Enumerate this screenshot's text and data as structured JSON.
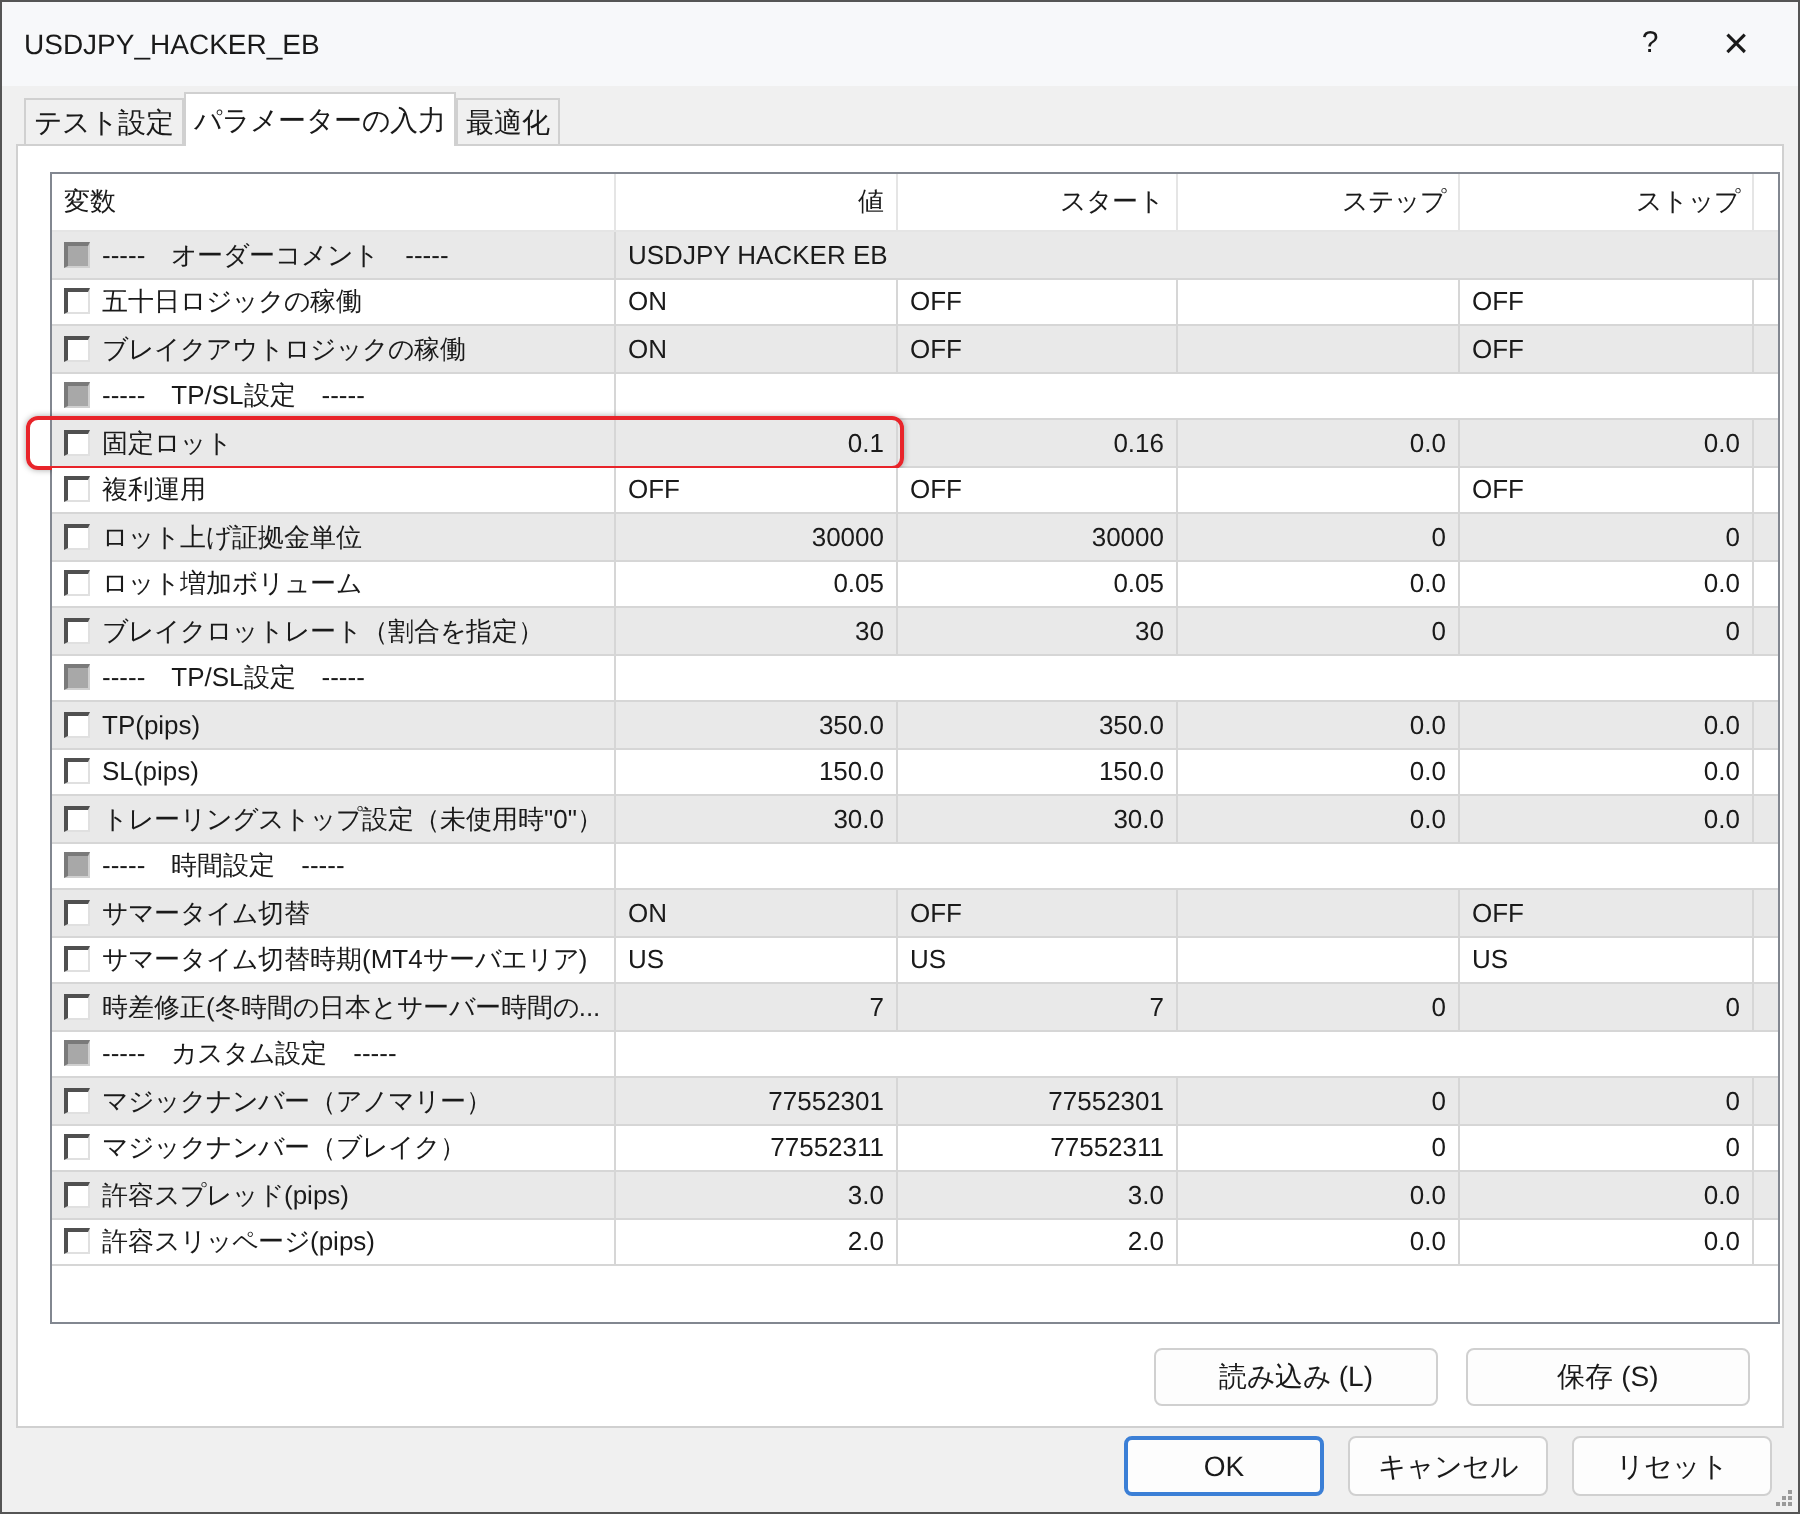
{
  "window": {
    "title": "USDJPY_HACKER_EB",
    "help": "?",
    "close": "×"
  },
  "tabs": [
    {
      "label": "テスト設定",
      "selected": false
    },
    {
      "label": "パラメーターの入力",
      "selected": true
    },
    {
      "label": "最適化",
      "selected": false
    }
  ],
  "table": {
    "columns": [
      "変数",
      "値",
      "スタート",
      "ステップ",
      "ストップ"
    ],
    "rows": [
      {
        "kind": "section",
        "name": "-----　オーダーコメント　-----",
        "checked": false,
        "disabled": true,
        "comment": "USDJPY HACKER EB",
        "highlighted": false
      },
      {
        "kind": "text",
        "name": "五十日ロジックの稼働",
        "checked": false,
        "disabled": false,
        "value": "ON",
        "start": "OFF",
        "stop": "OFF",
        "highlighted": false
      },
      {
        "kind": "text",
        "name": "ブレイクアウトロジックの稼働",
        "checked": false,
        "disabled": false,
        "value": "ON",
        "start": "OFF",
        "stop": "OFF",
        "highlighted": false
      },
      {
        "kind": "section",
        "name": "-----　TP/SL設定　-----",
        "checked": false,
        "disabled": true,
        "highlighted": false
      },
      {
        "kind": "number",
        "name": "固定ロット",
        "checked": false,
        "disabled": false,
        "value": "0.1",
        "start": "0.16",
        "step": "0.0",
        "stop": "0.0",
        "highlighted": true
      },
      {
        "kind": "text",
        "name": "複利運用",
        "checked": false,
        "disabled": false,
        "value": "OFF",
        "start": "OFF",
        "stop": "OFF",
        "highlighted": false
      },
      {
        "kind": "number",
        "name": "ロット上げ証拠金単位",
        "checked": false,
        "disabled": false,
        "value": "30000",
        "start": "30000",
        "step": "0",
        "stop": "0",
        "highlighted": false
      },
      {
        "kind": "number",
        "name": "ロット増加ボリューム",
        "checked": false,
        "disabled": false,
        "value": "0.05",
        "start": "0.05",
        "step": "0.0",
        "stop": "0.0",
        "highlighted": false
      },
      {
        "kind": "number",
        "name": "ブレイクロットレート（割合を指定）",
        "checked": false,
        "disabled": false,
        "value": "30",
        "start": "30",
        "step": "0",
        "stop": "0",
        "highlighted": false
      },
      {
        "kind": "section",
        "name": "-----　TP/SL設定　-----",
        "checked": false,
        "disabled": true,
        "highlighted": false
      },
      {
        "kind": "number",
        "name": "TP(pips)",
        "checked": false,
        "disabled": false,
        "value": "350.0",
        "start": "350.0",
        "step": "0.0",
        "stop": "0.0",
        "highlighted": false
      },
      {
        "kind": "number",
        "name": "SL(pips)",
        "checked": false,
        "disabled": false,
        "value": "150.0",
        "start": "150.0",
        "step": "0.0",
        "stop": "0.0",
        "highlighted": false
      },
      {
        "kind": "number",
        "name": "トレーリングストップ設定（未使用時\"0\"）",
        "checked": false,
        "disabled": false,
        "value": "30.0",
        "start": "30.0",
        "step": "0.0",
        "stop": "0.0",
        "highlighted": false
      },
      {
        "kind": "section",
        "name": "-----　時間設定　-----",
        "checked": false,
        "disabled": true,
        "highlighted": false
      },
      {
        "kind": "text",
        "name": "サマータイム切替",
        "checked": false,
        "disabled": false,
        "value": "ON",
        "start": "OFF",
        "stop": "OFF",
        "highlighted": false
      },
      {
        "kind": "text",
        "name": "サマータイム切替時期(MT4サーバエリア)",
        "checked": false,
        "disabled": false,
        "value": "US",
        "start": "US",
        "stop": "US",
        "highlighted": false
      },
      {
        "kind": "number",
        "name": "時差修正(冬時間の日本とサーバー時間の...",
        "checked": false,
        "disabled": false,
        "value": "7",
        "start": "7",
        "step": "0",
        "stop": "0",
        "highlighted": false
      },
      {
        "kind": "section",
        "name": "-----　カスタム設定　-----",
        "checked": false,
        "disabled": true,
        "highlighted": false
      },
      {
        "kind": "number",
        "name": "マジックナンバー（アノマリー）",
        "checked": false,
        "disabled": false,
        "value": "77552301",
        "start": "77552301",
        "step": "0",
        "stop": "0",
        "highlighted": false
      },
      {
        "kind": "number",
        "name": "マジックナンバー（ブレイク）",
        "checked": false,
        "disabled": false,
        "value": "77552311",
        "start": "77552311",
        "step": "0",
        "stop": "0",
        "highlighted": false
      },
      {
        "kind": "number",
        "name": "許容スプレッド(pips)",
        "checked": false,
        "disabled": false,
        "value": "3.0",
        "start": "3.0",
        "step": "0.0",
        "stop": "0.0",
        "highlighted": false
      },
      {
        "kind": "number",
        "name": "許容スリッページ(pips)",
        "checked": false,
        "disabled": false,
        "value": "2.0",
        "start": "2.0",
        "step": "0.0",
        "stop": "0.0",
        "highlighted": false
      }
    ]
  },
  "panel_buttons": [
    "読み込み (L)",
    "保存 (S)"
  ],
  "dialog_buttons": [
    {
      "label": "OK",
      "default": true
    },
    {
      "label": "キャンセル",
      "default": false
    },
    {
      "label": "リセット",
      "default": false
    }
  ]
}
